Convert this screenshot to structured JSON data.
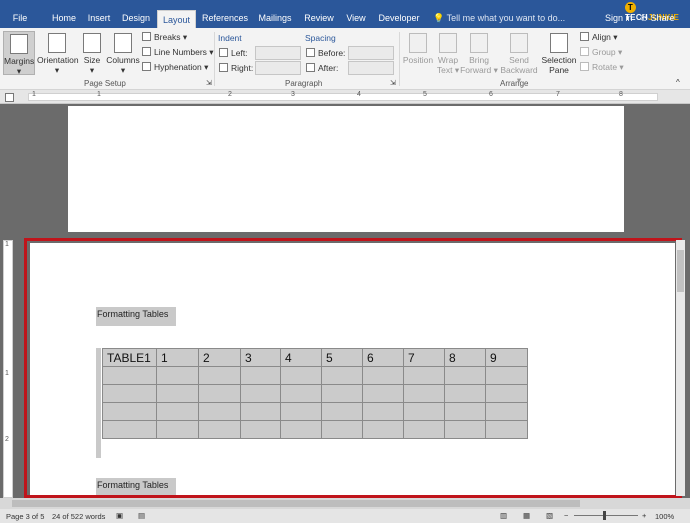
{
  "tabs": [
    {
      "label": "File",
      "active": false
    },
    {
      "label": "Home",
      "active": false
    },
    {
      "label": "Insert",
      "active": false
    },
    {
      "label": "Design",
      "active": false
    },
    {
      "label": "Layout",
      "active": true
    },
    {
      "label": "References",
      "active": false
    },
    {
      "label": "Mailings",
      "active": false
    },
    {
      "label": "Review",
      "active": false
    },
    {
      "label": "View",
      "active": false
    },
    {
      "label": "Developer",
      "active": false
    }
  ],
  "tell_me": "Tell me what you want to do...",
  "sign_in": "Sign in",
  "share": "Share",
  "logo": {
    "prefix": "TECH",
    "suffix": "JUNKIE",
    "mark": "T"
  },
  "page_setup": {
    "margins": "Margins",
    "orientation": "Orientation",
    "size": "Size",
    "columns": "Columns",
    "breaks": "Breaks",
    "line_numbers": "Line Numbers",
    "hyphenation": "Hyphenation",
    "group": "Page Setup"
  },
  "paragraph": {
    "indent": "Indent",
    "left": "Left:",
    "right": "Right:",
    "spacing": "Spacing",
    "before": "Before:",
    "after": "After:",
    "group": "Paragraph"
  },
  "arrange": {
    "position": "Position",
    "wrap1": "Wrap",
    "wrap2": "Text",
    "bring1": "Bring",
    "bring2": "Forward",
    "send1": "Send",
    "send2": "Backward",
    "selection1": "Selection",
    "selection2": "Pane",
    "align": "Align",
    "group_btn": "Group",
    "rotate": "Rotate",
    "group": "Arrange"
  },
  "ruler_numbers": [
    "1",
    "1",
    "2",
    "3",
    "4",
    "5",
    "6",
    "7",
    "8"
  ],
  "vruler_numbers": [
    "1",
    "1",
    "2"
  ],
  "doc": {
    "caption_top": "Formatting Tables",
    "caption_bottom": "Formatting Tables",
    "header_row": [
      "TABLE1",
      "1",
      "2",
      "3",
      "4",
      "5",
      "6",
      "7",
      "8",
      "9"
    ],
    "empty_rows": 4
  },
  "status": {
    "page": "Page 3 of 5",
    "words": "24 of 522 words",
    "zoom": "100%"
  }
}
